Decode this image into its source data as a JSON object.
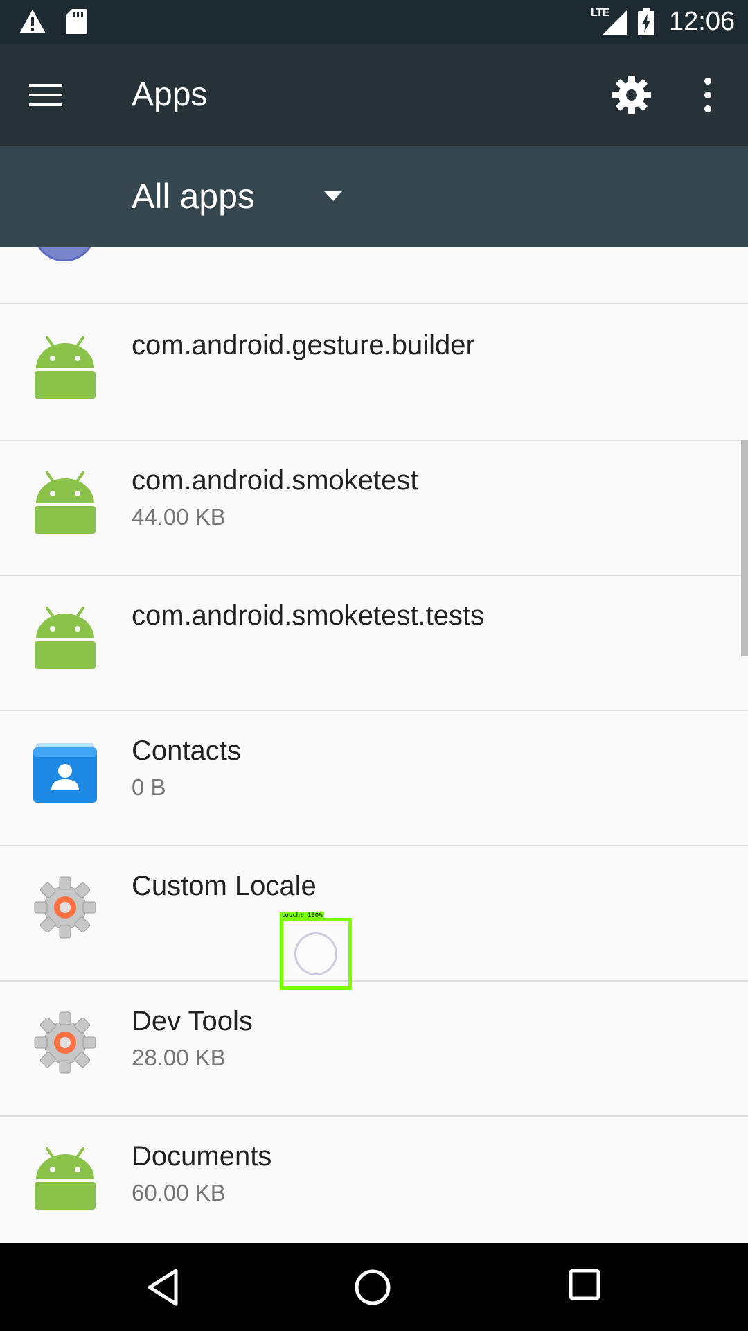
{
  "status_bar": {
    "network_label": "LTE",
    "time": "12:06",
    "icons": [
      "warning-icon",
      "sd-card-icon",
      "lte-signal-icon",
      "battery-charging-icon"
    ]
  },
  "toolbar": {
    "title": "Apps",
    "icons": [
      "menu-icon",
      "gear-icon",
      "more-vert-icon"
    ]
  },
  "filter": {
    "label": "All apps"
  },
  "apps": [
    {
      "name": "com.android.gesture.builder",
      "size": "",
      "icon": "android-robot-icon"
    },
    {
      "name": "com.android.smoketest",
      "size": "44.00 KB",
      "icon": "android-robot-icon"
    },
    {
      "name": "com.android.smoketest.tests",
      "size": "",
      "icon": "android-robot-icon"
    },
    {
      "name": "Contacts",
      "size": "0 B",
      "icon": "contacts-icon"
    },
    {
      "name": "Custom Locale",
      "size": "",
      "icon": "settings-gear-icon"
    },
    {
      "name": "Dev Tools",
      "size": "28.00 KB",
      "icon": "settings-gear-icon"
    },
    {
      "name": "Documents",
      "size": "60.00 KB",
      "icon": "android-robot-icon"
    }
  ],
  "touch_overlay": {
    "label": "touch: 100%"
  },
  "nav_bar": {
    "icons": [
      "back-icon",
      "home-icon",
      "recents-icon"
    ]
  },
  "colors": {
    "status_bar": "#1e2a31",
    "toolbar": "#263238",
    "filter_bar": "#37474f",
    "android_green": "#8bc34a",
    "contacts_blue": "#1e88e5",
    "touch_highlight": "#7cfc00"
  }
}
